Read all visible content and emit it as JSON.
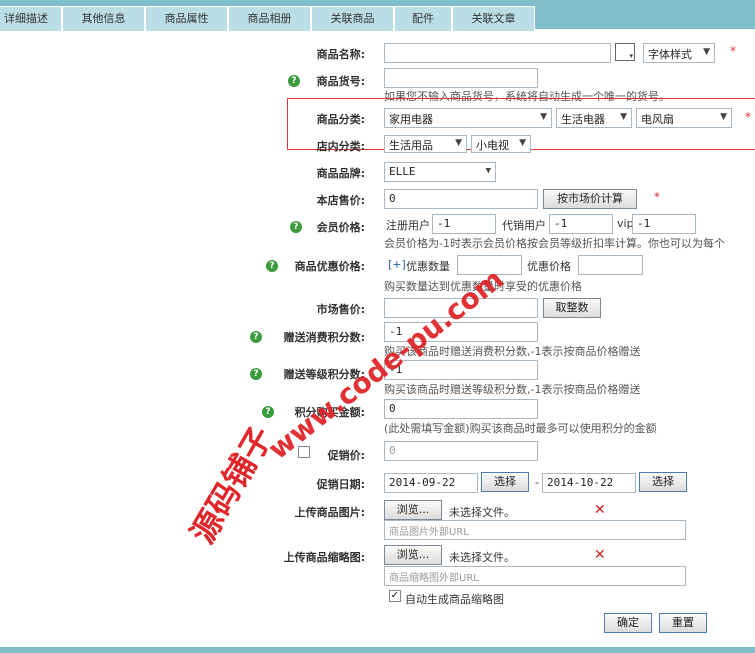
{
  "tabs": [
    "详细描述",
    "其他信息",
    "商品属性",
    "商品相册",
    "关联商品",
    "配件",
    "关联文章"
  ],
  "form": {
    "name": {
      "label": "商品名称:",
      "value": "",
      "font_style": "字体样式"
    },
    "sn": {
      "label": "商品货号:",
      "value": "",
      "note": "如果您不输入商品货号，系统将自动生成一个唯一的货号。"
    },
    "category": {
      "label": "商品分类:",
      "level1": "家用电器",
      "level2": "生活电器",
      "level3": "电风扇"
    },
    "shop_category": {
      "label": "店内分类:",
      "level1": "生活用品",
      "level2": "小电视"
    },
    "brand": {
      "label": "商品品牌:",
      "value": "ELLE"
    },
    "shop_price": {
      "label": "本店售价:",
      "value": "0",
      "button": "按市场价计算"
    },
    "member_price": {
      "label": "会员价格:",
      "registered_label": "注册用户",
      "registered_value": "-1",
      "agent_label": "代销用户",
      "agent_value": "-1",
      "vip_label": "vip",
      "vip_value": "-1",
      "note": "会员价格为-1时表示会员价格按会员等级折扣率计算。你也可以为每个"
    },
    "promo_price": {
      "label": "商品优惠价格:",
      "add": "[+]",
      "qty_label": "优惠数量",
      "price_label": "优惠价格",
      "note": "购买数量达到优惠数量时享受的优惠价格"
    },
    "market_price": {
      "label": "市场售价:",
      "value": "",
      "button": "取整数"
    },
    "give_integral": {
      "label": "赠送消费积分数:",
      "value": "-1",
      "note": "购买该商品时赠送消费积分数,-1表示按商品价格赠送"
    },
    "rank_integral": {
      "label": "赠送等级积分数:",
      "value": "-1",
      "note": "购买该商品时赠送等级积分数,-1表示按商品价格赠送"
    },
    "integral": {
      "label": "积分购买金额:",
      "value": "0",
      "note": "(此处需填写金额)购买该商品时最多可以使用积分的金额"
    },
    "promote_price": {
      "label": "促销价:",
      "value": "0"
    },
    "promote_date": {
      "label": "促销日期:",
      "start": "2014-09-22",
      "end": "2014-10-22",
      "select": "选择",
      "sep": "-"
    },
    "goods_img": {
      "label": "上传商品图片:",
      "browse": "浏览...",
      "no_file": "未选择文件。",
      "url_placeholder": "商品图片外部URL"
    },
    "goods_thumb": {
      "label": "上传商品缩略图:",
      "browse": "浏览...",
      "no_file": "未选择文件。",
      "url_placeholder": "商品缩略图外部URL"
    },
    "auto_thumb": {
      "label": "自动生成商品缩略图",
      "checked": true
    },
    "submit": "确定",
    "reset": "重置"
  },
  "required_mark": "*",
  "error_mark": "✕",
  "watermark": {
    "cn": "源码铺子",
    "url": "www.code-pu.com"
  }
}
